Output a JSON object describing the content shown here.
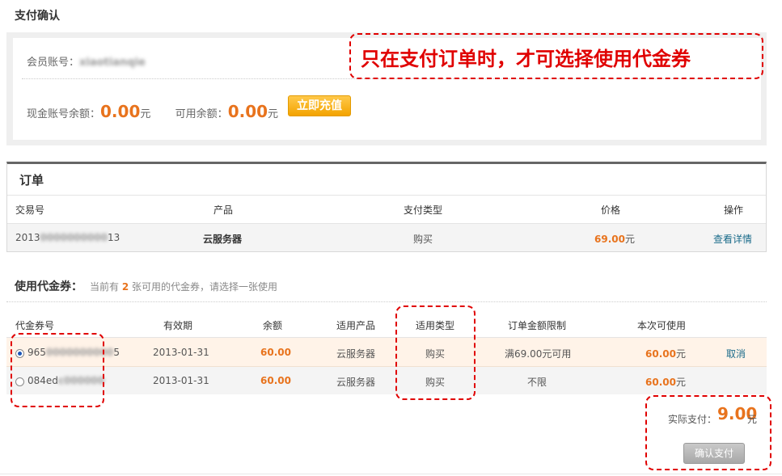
{
  "page_title": "支付确认",
  "account": {
    "member_label": "会员账号：",
    "member_value": "xiaotianqie",
    "cash_label": "现金账号余额：",
    "cash_value": "0.00",
    "cash_unit": "元",
    "avail_label": "可用余额：",
    "avail_value": "0.00",
    "avail_unit": "元",
    "recharge_label": "立即充值"
  },
  "annotations": {
    "callout_text": "只在支付订单时，才可选择使用代金券"
  },
  "order": {
    "title": "订单",
    "headers": [
      "交易号",
      "产品",
      "支付类型",
      "价格",
      "操作"
    ],
    "row": {
      "id_prefix": "2013",
      "id_hidden": "0000000000",
      "id_suffix": "13",
      "product": "云服务器",
      "pay_type": "购买",
      "price": "69.00",
      "price_unit": "元",
      "action": "查看详情"
    }
  },
  "coupons": {
    "title": "使用代金券：",
    "hint_pre": "当前有",
    "hint_count": "2",
    "hint_post": "张可用的代金券，请选择一张使用",
    "headers": [
      "代金券号",
      "有效期",
      "余额",
      "适用产品",
      "适用类型",
      "订单金额限制",
      "本次可使用"
    ],
    "rows": [
      {
        "selected": true,
        "code_visible": "965",
        "code_hidden": "0000000000",
        "code_tail": "5",
        "expiry": "2013-01-31",
        "balance": "60.00",
        "product": "云服务器",
        "type": "购买",
        "limit": "满69.00元可用",
        "usable": "60.00",
        "usable_unit": "元",
        "action": "取消"
      },
      {
        "selected": false,
        "code_visible": "084ed",
        "code_hidden": "c000000",
        "code_tail": "",
        "expiry": "2013-01-31",
        "balance": "60.00",
        "product": "云服务器",
        "type": "购买",
        "limit": "不限",
        "usable": "60.00",
        "usable_unit": "元",
        "action": ""
      }
    ]
  },
  "payment": {
    "label": "实际支付：",
    "value": "9.00",
    "unit": "元",
    "confirm_label": "确认支付"
  },
  "colors": {
    "accent_orange": "#e8731d",
    "annotation_red": "#e00000",
    "link_blue": "#1a6b8a"
  }
}
